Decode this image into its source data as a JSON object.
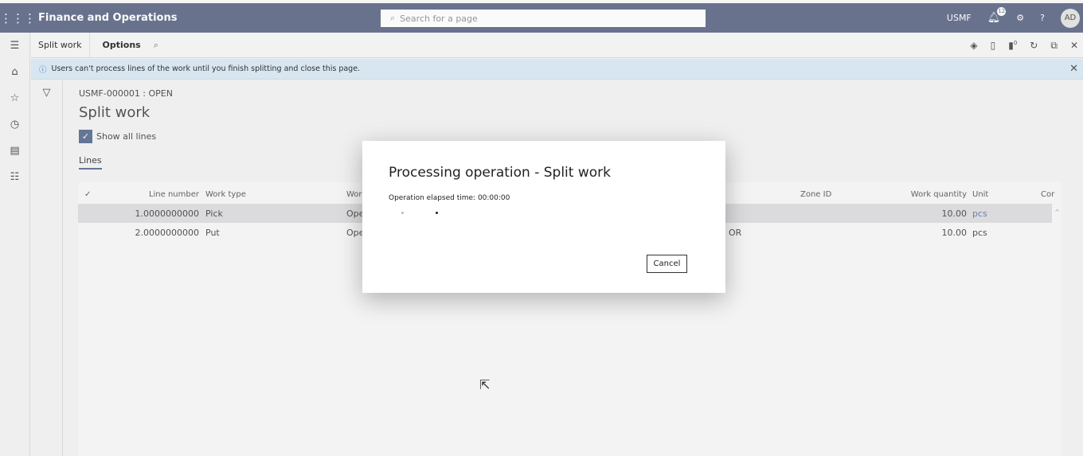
{
  "app": {
    "title": "Finance and Operations",
    "search_placeholder": "Search for a page",
    "company": "USMF",
    "notifications": "12",
    "avatar": "AD",
    "workspace_badge": "0"
  },
  "actionbar": {
    "page": "Split work",
    "options": "Options"
  },
  "info": {
    "message": "Users can't process lines of the work until you finish splitting and close this page."
  },
  "page": {
    "breadcrumb": "USMF-000001 : OPEN",
    "title": "Split work",
    "show_all_lines": "Show all lines",
    "show_all_checked": true,
    "tab": "Lines"
  },
  "grid": {
    "headers": {
      "line_number": "Line number",
      "work_type": "Work type",
      "work": "Wor",
      "zone": "Zone ID",
      "qty": "Work quantity",
      "unit": "Unit",
      "cor": "Cor"
    },
    "rows": [
      {
        "line_number": "1.0000000000",
        "work_type": "Pick",
        "work": "Ope",
        "loc": "",
        "qty": "10.00",
        "unit": "pcs"
      },
      {
        "line_number": "2.0000000000",
        "work_type": "Put",
        "work": "Ope",
        "loc": "OR",
        "qty": "10.00",
        "unit": "pcs"
      }
    ]
  },
  "dialog": {
    "title": "Processing operation - Split work",
    "elapsed": "Operation elapsed time: 00:00:00",
    "cancel": "Cancel"
  }
}
